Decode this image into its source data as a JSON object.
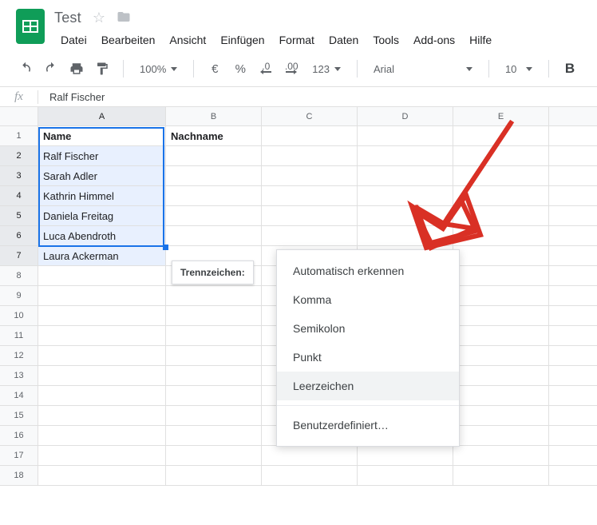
{
  "doc_title": "Test",
  "menus": {
    "datei": "Datei",
    "bearbeiten": "Bearbeiten",
    "ansicht": "Ansicht",
    "einfuegen": "Einfügen",
    "format": "Format",
    "daten": "Daten",
    "tools": "Tools",
    "addons": "Add-ons",
    "hilfe": "Hilfe"
  },
  "toolbar": {
    "zoom": "100%",
    "currency": "€",
    "percent": "%",
    "dec_less": ".0",
    "dec_more": ".00",
    "num_format": "123",
    "font_name": "Arial",
    "font_size": "10",
    "bold": "B"
  },
  "fx": {
    "label": "fx",
    "value": "Ralf Fischer"
  },
  "columns": [
    "A",
    "B",
    "C",
    "D",
    "E"
  ],
  "header_row": {
    "A": "Name",
    "B": "Nachname"
  },
  "names": [
    "Ralf Fischer",
    "Sarah Adler",
    "Kathrin Himmel",
    "Daniela Freitag",
    "Luca Abendroth",
    "Laura Ackerman"
  ],
  "row_count": 18,
  "separator_label": "Trennzeichen:",
  "dropdown": {
    "auto": "Automatisch erkennen",
    "komma": "Komma",
    "semikolon": "Semikolon",
    "punkt": "Punkt",
    "leerzeichen": "Leerzeichen",
    "custom": "Benutzerdefiniert…"
  },
  "chart_data": null
}
